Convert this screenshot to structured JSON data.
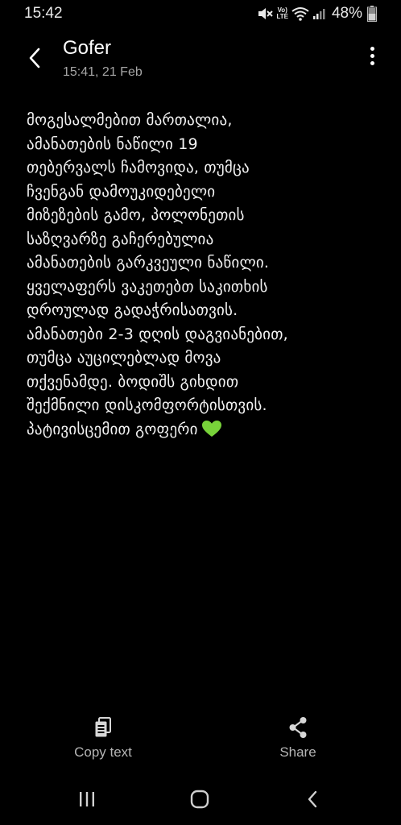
{
  "status_bar": {
    "time": "15:42",
    "lte_label": "Vo)\nLTE",
    "battery": "48%"
  },
  "header": {
    "sender": "Gofer",
    "timestamp": "15:41, 21 Feb",
    "back_icon": "chevron-left-icon",
    "more_icon": "more-vertical-icon"
  },
  "message": {
    "text": "მოგესალმებით მართალია,\nამანათების ნაწილი 19\nთებერვალს ჩამოვიდა, თუმცა\nჩვენგან დამოუკიდებელი\nმიზეზების გამო, პოლონეთის\nსაზღვარზე გაჩერებულია\nამანათების გარკვეული ნაწილი.\nყველაფერს ვაკეთებთ საკითხის\nდროულად გადაჭრისათვის.\nამანათები 2-3 დღის დაგვიანებით,\nთუმცა აუცილებლად მოვა\nთქვენამდე. ბოდიშს გიხდით\nშექმნილი დისკომფორტისთვის.\nპატივისცემით გოფერი",
    "emoji": "green-heart",
    "emoji_color": "#78d23a"
  },
  "actions": {
    "copy_label": "Copy text",
    "share_label": "Share"
  },
  "navbar": {
    "recents_icon": "recents-icon",
    "home_icon": "home-icon",
    "back_icon": "back-icon"
  }
}
